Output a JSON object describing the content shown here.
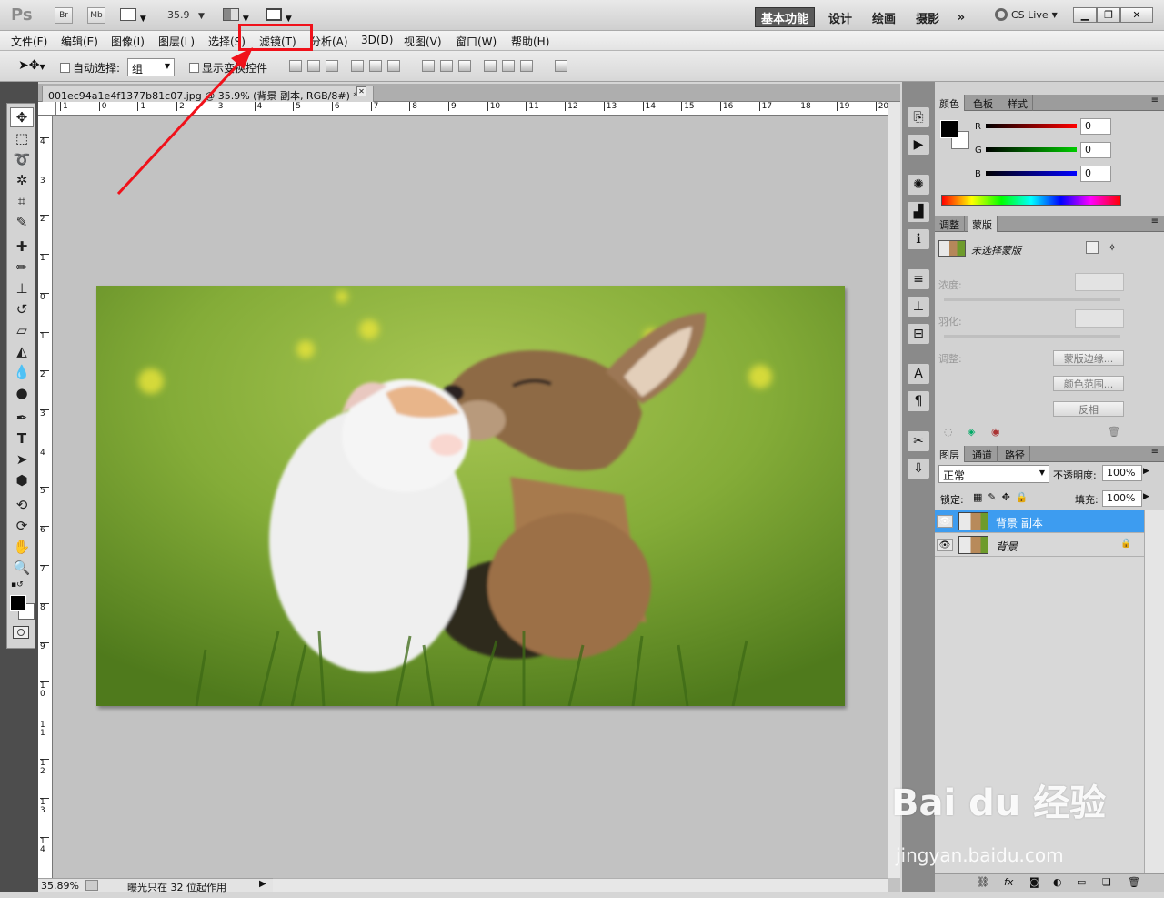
{
  "app": {
    "logo": "Ps",
    "bridge_button": "Br",
    "minibridge_button": "Mb",
    "zoom_value": "35.9",
    "workspaces": [
      "基本功能",
      "设计",
      "绘画",
      "摄影"
    ],
    "more_workspaces": "»",
    "cs_live": "CS Live"
  },
  "menu": [
    "文件(F)",
    "编辑(E)",
    "图像(I)",
    "图层(L)",
    "选择(S)",
    "滤镜(T)",
    "分析(A)",
    "3D(D)",
    "视图(V)",
    "窗口(W)",
    "帮助(H)"
  ],
  "options": {
    "auto_select_label": "自动选择:",
    "auto_select_value": "组",
    "show_transform_label": "显示变换控件"
  },
  "document": {
    "tab_title": "001ec94a1e4f1377b81c07.jpg @ 35.9% (背景 副本, RGB/8#) *",
    "ruler_h": [
      "1",
      "0",
      "1",
      "2",
      "3",
      "4",
      "5",
      "6",
      "7",
      "8",
      "9",
      "10",
      "11",
      "12",
      "13",
      "14",
      "15",
      "16",
      "17",
      "18",
      "19",
      "20"
    ],
    "ruler_v": [
      "4",
      "3",
      "2",
      "1",
      "0",
      "1",
      "2",
      "3",
      "4",
      "5",
      "6",
      "7",
      "8",
      "9",
      "10",
      "11",
      "12",
      "13",
      "14"
    ],
    "zoom_status": "35.89%",
    "status_text": "曝光只在 32 位起作用"
  },
  "color_panel": {
    "tabs": [
      "颜色",
      "色板",
      "样式"
    ],
    "r_label": "R",
    "g_label": "G",
    "b_label": "B",
    "r_value": "0",
    "g_value": "0",
    "b_value": "0"
  },
  "mask_panel": {
    "tabs": [
      "调整",
      "蒙版"
    ],
    "no_mask": "未选择蒙版",
    "density_label": "浓度:",
    "feather_label": "羽化:",
    "refine_label": "调整:",
    "mask_edge_button": "蒙版边缘...",
    "color_range_button": "颜色范围...",
    "invert_button": "反相"
  },
  "layers_panel": {
    "tabs": [
      "图层",
      "通道",
      "路径"
    ],
    "blend_mode": "正常",
    "opacity_label": "不透明度:",
    "opacity_value": "100%",
    "lock_label": "锁定:",
    "fill_label": "填充:",
    "fill_value": "100%",
    "layers": [
      {
        "name": "背景 副本",
        "selected": true
      },
      {
        "name": "背景",
        "selected": false
      }
    ]
  },
  "watermark": {
    "brand": "Bai du 经验",
    "url": "jingyan.baidu.com"
  },
  "colors": {
    "selection_blue": "#3d9cf0",
    "annotation_red": "#f0111a"
  }
}
